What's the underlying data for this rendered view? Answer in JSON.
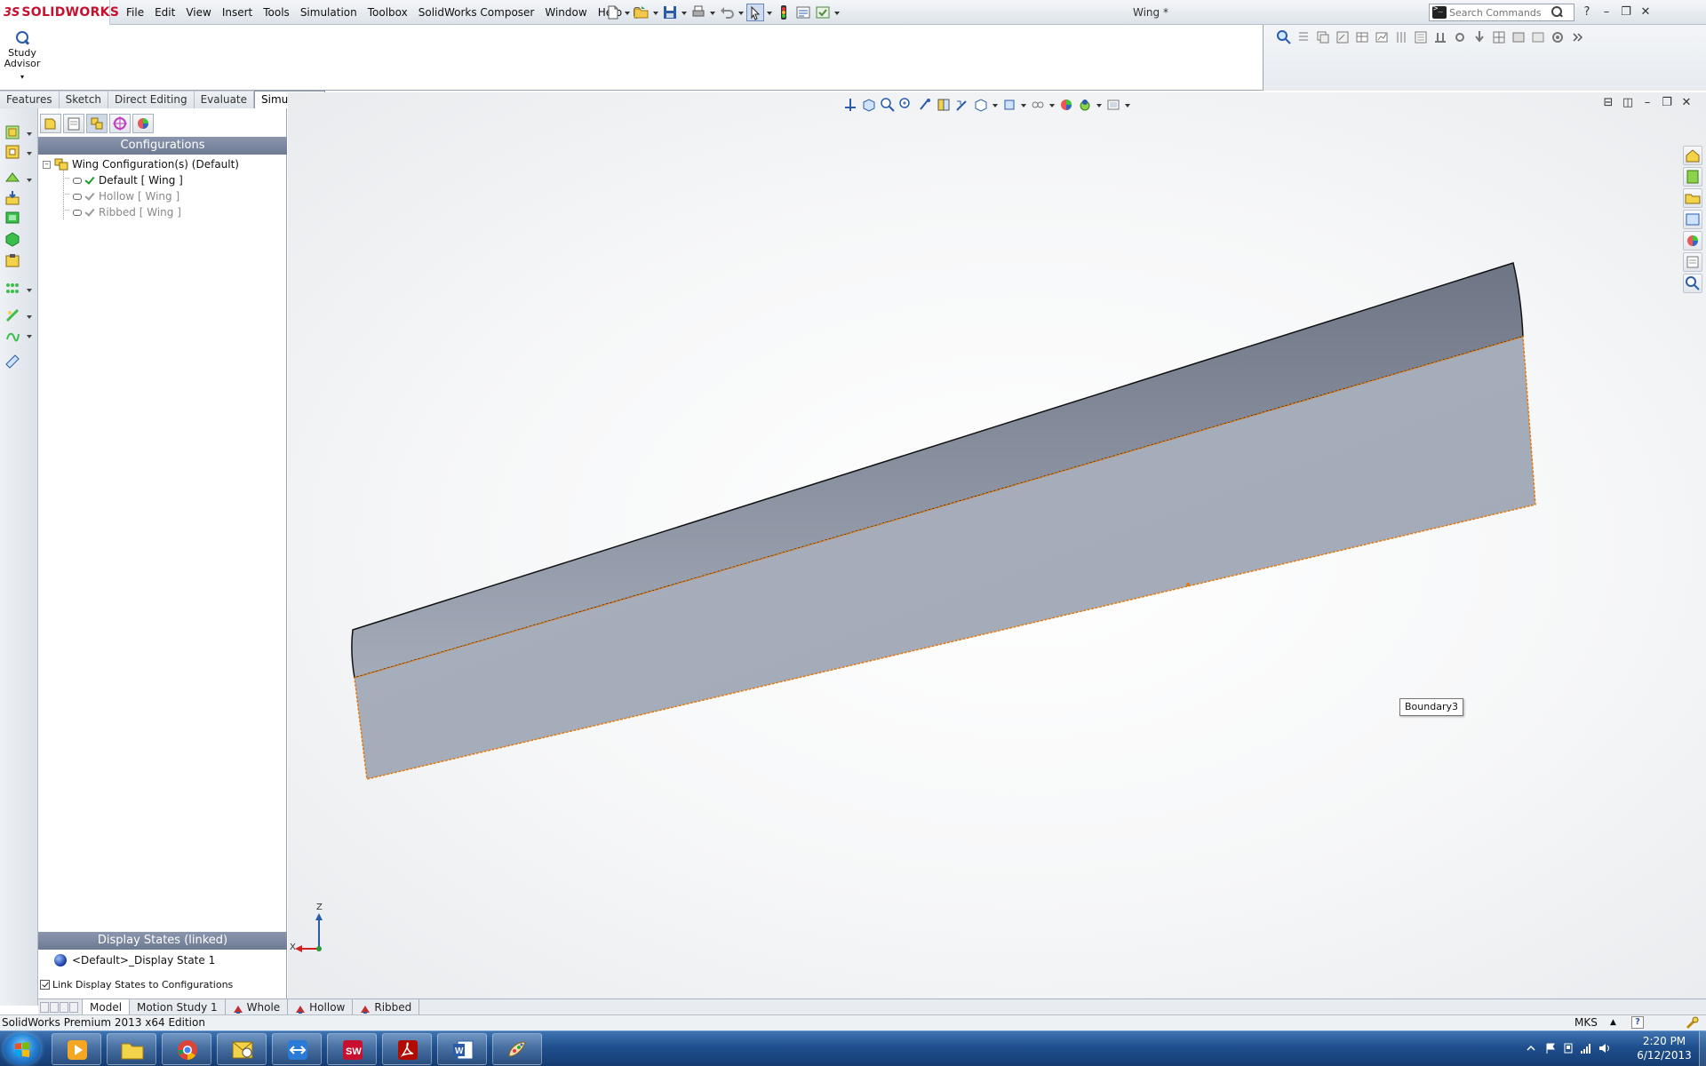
{
  "app": {
    "brand_prefix": "3S",
    "brand": "SOLIDWORKS",
    "doc_title": "Wing *"
  },
  "menu": {
    "items": [
      "File",
      "Edit",
      "View",
      "Insert",
      "Tools",
      "Simulation",
      "Toolbox",
      "SolidWorks Composer",
      "Window",
      "Help"
    ]
  },
  "search": {
    "placeholder": "Search Commands"
  },
  "command_manager": {
    "study_advisor_line1": "Study",
    "study_advisor_line2": "Advisor",
    "tabs": [
      {
        "label": "Features",
        "active": false
      },
      {
        "label": "Sketch",
        "active": false
      },
      {
        "label": "Direct Editing",
        "active": false
      },
      {
        "label": "Evaluate",
        "active": false
      },
      {
        "label": "Simulation",
        "active": true
      }
    ]
  },
  "feature_manager": {
    "header": "Configurations",
    "root": "Wing Configuration(s)  (Default)",
    "configs": [
      {
        "label": "Default [ Wing ]",
        "active": true
      },
      {
        "label": "Hollow [ Wing ]",
        "active": false
      },
      {
        "label": "Ribbed [ Wing ]",
        "active": false
      }
    ],
    "display_states_header": "Display States (linked)",
    "display_state": "<Default>_Display State 1",
    "link_checkbox_label": "Link Display States to Configurations",
    "link_checked": true
  },
  "viewport": {
    "tooltip": "Boundary3",
    "triad_x": "X",
    "triad_z": "Z",
    "edge_color": "#e07a10",
    "body_color": "#a9b0be"
  },
  "bottom_tabs": [
    {
      "label": "Model",
      "active": true,
      "cfg": false
    },
    {
      "label": "Motion Study 1",
      "active": false,
      "cfg": false
    },
    {
      "label": "Whole",
      "active": false,
      "cfg": true
    },
    {
      "label": "Hollow",
      "active": false,
      "cfg": true
    },
    {
      "label": "Ribbed",
      "active": false,
      "cfg": true
    }
  ],
  "status": {
    "text": "SolidWorks Premium 2013 x64 Edition",
    "units": "MKS",
    "units_drop": "▲",
    "help": "?"
  },
  "taskbar": {
    "apps": [
      "media-player",
      "file-explorer",
      "chrome",
      "outlook",
      "teamviewer",
      "solidworks",
      "acrobat",
      "word",
      "paint"
    ],
    "time": "2:20 PM",
    "date": "6/12/2013"
  }
}
